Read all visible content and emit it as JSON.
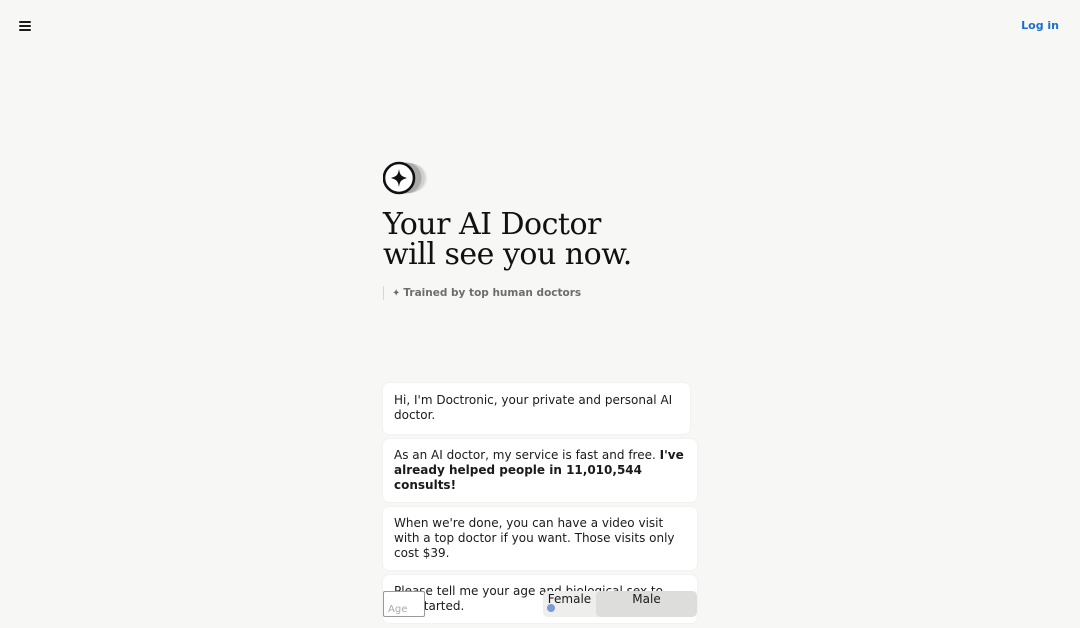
{
  "header": {
    "menu_icon": "hamburger-menu-icon",
    "login_label": "Log in"
  },
  "hero": {
    "logo_icon": "sparkle-star-circle-logo",
    "headline_line1": "Your AI Doctor",
    "headline_line2": "will see you now.",
    "tagline_icon": "sparkle-icon",
    "tagline": "Trained by top human doctors"
  },
  "chat": {
    "messages": [
      {
        "text": "Hi, I'm Doctronic, your private and personal AI doctor."
      },
      {
        "text": "As an AI doctor, my service is fast and free. ",
        "strong": "I've already helped people in 11,010,544 consults!"
      },
      {
        "text": "When we're done, you can have a video visit with a top doctor if you want. Those visits only cost $39."
      },
      {
        "text": "Please tell me your age and biological sex to get started."
      }
    ]
  },
  "answer": {
    "age_placeholder": "Age",
    "sex_options": [
      "Female",
      "Male"
    ],
    "selected": "Male"
  },
  "colors": {
    "background": "#f7f7f5",
    "link": "#1a6fd4",
    "bubble": "#ffffff"
  }
}
